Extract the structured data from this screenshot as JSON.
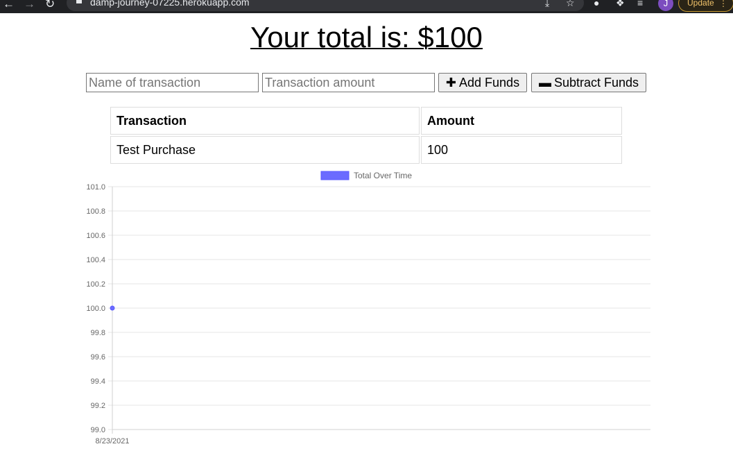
{
  "browser": {
    "url": "damp-journey-07225.herokuapp.com",
    "profile_initial": "J",
    "update_label": "Update"
  },
  "page": {
    "title": "Your total is: $",
    "total": "100"
  },
  "form": {
    "name_placeholder": "Name of transaction",
    "amount_placeholder": "Transaction amount",
    "add_label": "Add Funds",
    "subtract_label": "Subtract Funds"
  },
  "table": {
    "headers": [
      "Transaction",
      "Amount"
    ],
    "rows": [
      {
        "name": "Test Purchase",
        "amount": "100"
      }
    ]
  },
  "colors": {
    "series": "#6b6bff"
  },
  "chart_data": {
    "type": "line",
    "title": "",
    "xlabel": "",
    "ylabel": "",
    "legend_position": "top",
    "grid": true,
    "x": [
      "8/23/2021"
    ],
    "y_ticks": [
      "101.0",
      "100.8",
      "100.6",
      "100.4",
      "100.2",
      "100.0",
      "99.8",
      "99.6",
      "99.4",
      "99.2",
      "99.0"
    ],
    "ylim": [
      99.0,
      101.0
    ],
    "series": [
      {
        "name": "Total Over Time",
        "values": [
          100
        ]
      }
    ]
  }
}
